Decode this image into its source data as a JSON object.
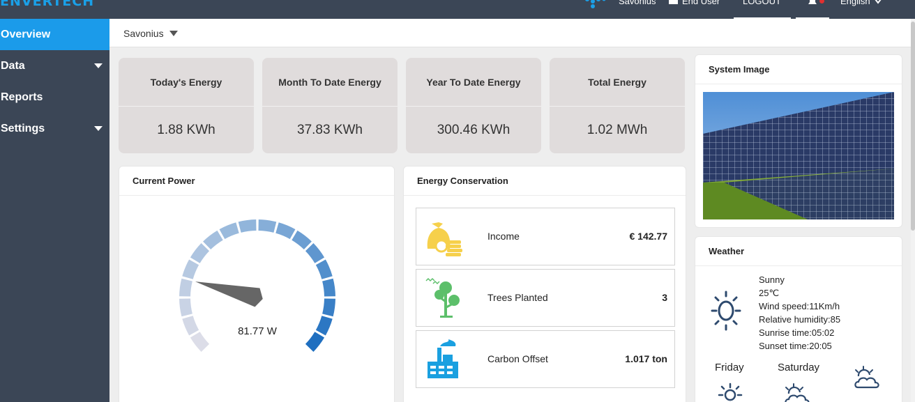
{
  "app": {
    "logo": "ENVERTECH"
  },
  "topbar": {
    "user_plant": "Savonius",
    "end_user": "End User",
    "logout": "LOGOUT",
    "language": "English"
  },
  "sidebar": {
    "items": [
      {
        "label": "Overview",
        "active": true,
        "has_caret": false
      },
      {
        "label": "Data",
        "active": false,
        "has_caret": true
      },
      {
        "label": "Reports",
        "active": false,
        "has_caret": false
      },
      {
        "label": "Settings",
        "active": false,
        "has_caret": true
      }
    ]
  },
  "plant_selector": {
    "value": "Savonius"
  },
  "kpis": [
    {
      "title": "Today's Energy",
      "value": "1.88 KWh"
    },
    {
      "title": "Month To Date Energy",
      "value": "37.83 KWh"
    },
    {
      "title": "Year To Date Energy",
      "value": "300.46 KWh"
    },
    {
      "title": "Total Energy",
      "value": "1.02 MWh"
    }
  ],
  "current_power": {
    "title": "Current Power",
    "value_label": "81.77 W",
    "gauge_fraction": 0.22
  },
  "energy_conservation": {
    "title": "Energy Conservation",
    "rows": [
      {
        "icon": "money-bag-icon",
        "label": "Income",
        "value": "€ 142.77"
      },
      {
        "icon": "tree-icon",
        "label": "Trees Planted",
        "value": "3"
      },
      {
        "icon": "factory-icon",
        "label": "Carbon Offset",
        "value": "1.017 ton"
      }
    ]
  },
  "system_image": {
    "title": "System Image"
  },
  "weather": {
    "title": "Weather",
    "condition": "Sunny",
    "temperature": "25℃",
    "wind": "Wind speed:11Km/h",
    "humidity": "Relative humidity:85",
    "sunrise": "Sunrise time:05:02",
    "sunset": "Sunset time:20:05",
    "forecast": [
      {
        "day": "Friday",
        "icon": "sun-icon"
      },
      {
        "day": "Saturday",
        "icon": "partly-cloudy-icon"
      },
      {
        "day": "",
        "icon": "partly-cloudy-icon"
      }
    ]
  },
  "colors": {
    "sidebar_bg": "#3b4656",
    "accent": "#1b9bea",
    "kpi_bg": "#e0dcdc",
    "gauge_dark": "#1f6fc0",
    "gauge_light": "#dcdde8",
    "eco_yellow": "#f6d04b",
    "eco_green": "#5cbf6a",
    "eco_blue": "#1aa0e0",
    "weather_icon": "#2e4a6e"
  }
}
